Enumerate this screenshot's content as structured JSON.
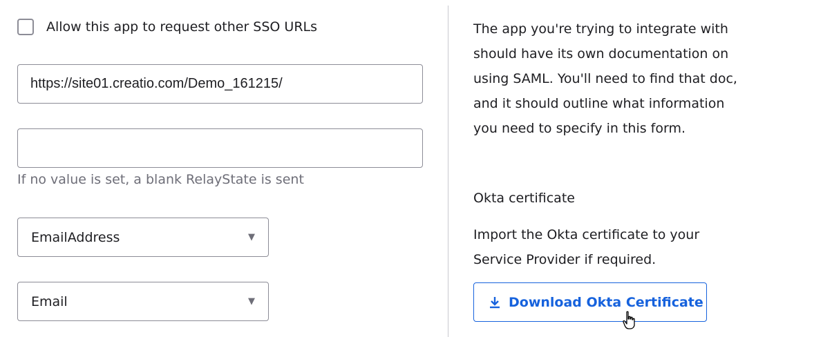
{
  "sso": {
    "allow_other_urls_label": "Allow this app to request other SSO URLs",
    "allow_other_urls_checked": false
  },
  "url_field": {
    "value": "https://site01.creatio.com/Demo_161215/"
  },
  "relay_state": {
    "value": "",
    "hint": "If no value is set, a blank RelayState is sent"
  },
  "name_id_format": {
    "selected": "EmailAddress"
  },
  "app_username": {
    "selected": "Email"
  },
  "help": {
    "intro": "The app you're trying to integrate with should have its own documentation on using SAML. You'll need to find that doc, and it should outline what information you need to specify in this form.",
    "cert_heading": "Okta certificate",
    "cert_text": "Import the Okta certificate to your Service Provider if required.",
    "download_label": "Download Okta Certificate"
  },
  "colors": {
    "accent": "#1662dd",
    "border": "#8c8c96",
    "hint": "#6e6e78"
  },
  "icons": {
    "download": "download-icon",
    "caret": "caret-down-icon",
    "cursor": "hand-pointer-cursor"
  }
}
